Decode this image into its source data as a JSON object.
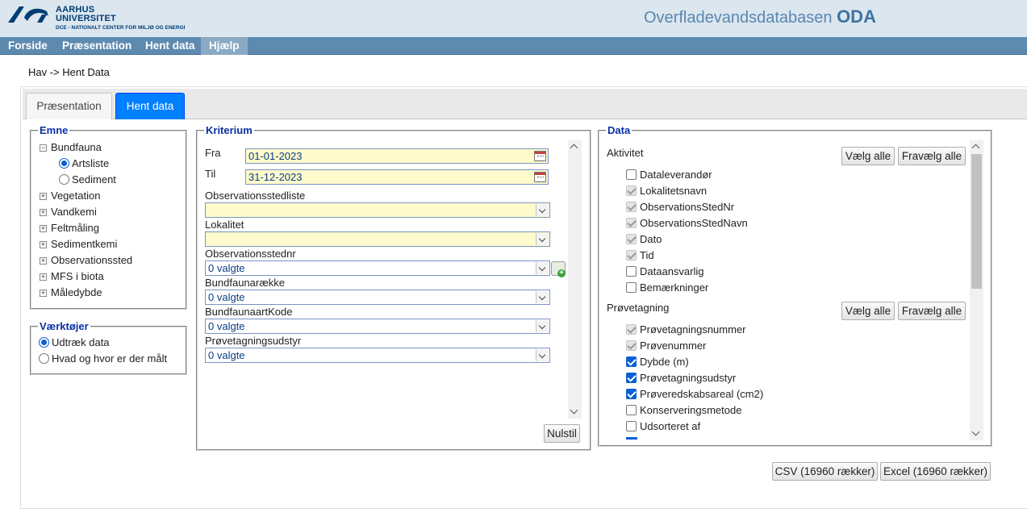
{
  "header": {
    "uni_line1": "AARHUS",
    "uni_line2": "UNIVERSITET",
    "uni_line3": "DCE - NATIONALT CENTER FOR MILJØ OG ENERGI",
    "app_title": "Overfladevandsdatabasen",
    "app_abbrev": "ODA"
  },
  "menu": [
    "Forside",
    "Præsentation",
    "Hent data",
    "Hjælp"
  ],
  "breadcrumb": "Hav -> Hent Data",
  "tabs": [
    "Præsentation",
    "Hent data"
  ],
  "emne": {
    "legend": "Emne",
    "root": "Bundfauna",
    "children": [
      "Artsliste",
      "Sediment"
    ],
    "items": [
      "Vegetation",
      "Vandkemi",
      "Feltmåling",
      "Sedimentkemi",
      "Observationssted",
      "MFS i biota",
      "Måledybde"
    ]
  },
  "vaerktojer": {
    "legend": "Værktøjer",
    "options": [
      "Udtræk data",
      "Hvad og hvor er der målt"
    ]
  },
  "kriterium": {
    "legend": "Kriterium",
    "fra_label": "Fra",
    "fra_value": "01-01-2023",
    "til_label": "Til",
    "til_value": "31-12-2023",
    "fields": [
      {
        "label": "Observationsstedliste",
        "value": ""
      },
      {
        "label": "Lokalitet",
        "value": ""
      },
      {
        "label": "Observationsstednr",
        "value": "0 valgte"
      },
      {
        "label": "Bundfaunarække",
        "value": "0 valgte"
      },
      {
        "label": "BundfaunaartKode",
        "value": "0 valgte"
      },
      {
        "label": "Prøvetagningsudstyr",
        "value": "0 valgte"
      }
    ],
    "reset_button": "Nulstil"
  },
  "data": {
    "legend": "Data",
    "select_all": "Vælg alle",
    "deselect_all": "Fravælg alle",
    "aktivitet": {
      "title": "Aktivitet",
      "items": [
        {
          "label": "Dataleverandør",
          "state": "unchecked"
        },
        {
          "label": "Lokalitetsnavn",
          "state": "disabled"
        },
        {
          "label": "ObservationsStedNr",
          "state": "disabled"
        },
        {
          "label": "ObservationsStedNavn",
          "state": "disabled"
        },
        {
          "label": "Dato",
          "state": "disabled"
        },
        {
          "label": "Tid",
          "state": "disabled"
        },
        {
          "label": "Dataansvarlig",
          "state": "unchecked"
        },
        {
          "label": "Bemærkninger",
          "state": "unchecked"
        }
      ]
    },
    "provetagning": {
      "title": "Prøvetagning",
      "items": [
        {
          "label": "Prøvetagningsnummer",
          "state": "disabled"
        },
        {
          "label": "Prøvenummer",
          "state": "disabled"
        },
        {
          "label": "Dybde (m)",
          "state": "checked"
        },
        {
          "label": "Prøvetagningsudstyr",
          "state": "checked"
        },
        {
          "label": "Prøveredskabsareal (cm2)",
          "state": "checked"
        },
        {
          "label": "Konserveringsmetode",
          "state": "unchecked"
        },
        {
          "label": "Udsorteret af",
          "state": "unchecked"
        }
      ]
    }
  },
  "export": {
    "csv": "CSV (16960 rækker)",
    "excel": "Excel (16960 rækker)"
  },
  "colors": {
    "header_bg": "#dbe6ef",
    "menu_bg": "#5e8ab0",
    "active_tab": "#007fff",
    "legend_text": "#0a2fa5",
    "input_bg": "#fffbcc"
  }
}
